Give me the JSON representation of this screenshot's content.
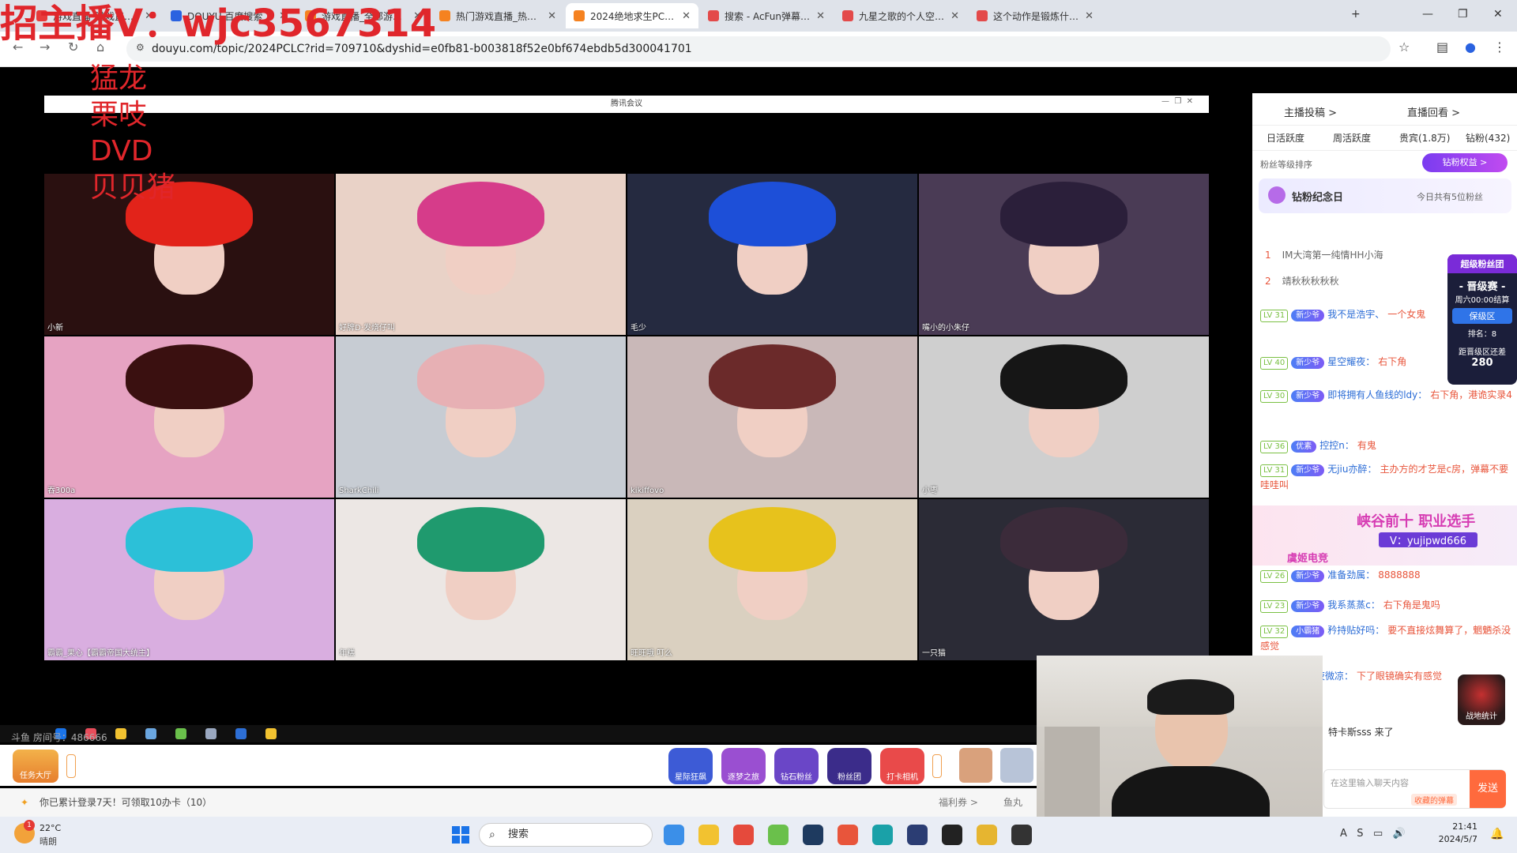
{
  "browser": {
    "tabs": [
      {
        "title": "游戏直播_游戏直播...",
        "color": "#e73b3b"
      },
      {
        "title": "DOUYU 百度搜索",
        "color": "#2a62e0"
      },
      {
        "title": "游戏直播_全部游戏直播...",
        "color": "#f58220"
      },
      {
        "title": "热门游戏直播_热门游戏视...",
        "color": "#f58220"
      },
      {
        "title": "2024绝地求生PCL春季...",
        "color": "#f58220"
      },
      {
        "title": "搜索 - AcFun弹幕视频网",
        "color": "#e34a4a"
      },
      {
        "title": "九星之歌的个人空间 -Ac...",
        "color": "#e34a4a"
      },
      {
        "title": "这个动作是锻炼什么的?",
        "color": "#e34a4a"
      }
    ],
    "active_tab_index": 4,
    "url": "douyu.com/topic/2024PCLC?rid=709710&dyshid=e0fb81-b003818f52e0bf674ebdb5d300041701"
  },
  "overlay": {
    "title": "招主播V：wjc3567314",
    "names": [
      "猛龙",
      "栗吱",
      "DVD",
      "贝贝猪"
    ],
    "color": "#e0262b"
  },
  "meeting": {
    "window_title": "腾讯会议",
    "tiles": [
      {
        "label": "小新",
        "hair": "#e2231a",
        "bg": "#2a1010"
      },
      {
        "label": "好牌D·发烧仔叫",
        "hair": "#d63c8a",
        "bg": "#e9d2c7"
      },
      {
        "label": "毛少",
        "hair": "#1d4fd8",
        "bg": "#252a40"
      },
      {
        "label": "嘴小的小朱仔",
        "hair": "#2b1f3a",
        "bg": "#4a3b55"
      },
      {
        "label": "吞300a",
        "hair": "#3a1010",
        "bg": "#e6a3c2"
      },
      {
        "label": "SharkChili",
        "hair": "#e7b0b4",
        "bg": "#c7ccd3"
      },
      {
        "label": "kikiffovo",
        "hair": "#6b2a2a",
        "bg": "#c9b8b8"
      },
      {
        "label": "小枣",
        "hair": "#161616",
        "bg": "#cfcfcf"
      },
      {
        "label": "霸霸_果心【霸霸帝国大统主】",
        "hair": "#2cc0d8",
        "bg": "#d9aee0"
      },
      {
        "label": "年糕",
        "hair": "#1f9a6e",
        "bg": "#ece7e4"
      },
      {
        "label": "旺旺哦 叮么",
        "hair": "#e7c21c",
        "bg": "#dad0c0"
      },
      {
        "label": "一只猫",
        "hair": "#3b2b3a",
        "bg": "#2b2b36"
      }
    ]
  },
  "stream": {
    "room_number": "斗鱼 房间号：486666"
  },
  "douyu_bar": {
    "task_hall": "任务大厅",
    "gifts": [
      "星际狂飙",
      "逐梦之旅",
      "钻石粉丝",
      "粉丝团",
      "打卡相机"
    ],
    "gift_colors": [
      "#3d5bd6",
      "#9a4fd1",
      "#6a46c7",
      "#3b2c8a",
      "#e94a4a"
    ],
    "login_message": "你已累计登录7天！可领取10办卡（10）",
    "welfare": "福利券 >",
    "fish": "鱼丸"
  },
  "sidebar": {
    "top_links": [
      "主播投稿 >",
      "直播回看 >"
    ],
    "tabs": [
      "日活跃度",
      "周活跃度",
      "贵宾(1.8万)",
      "钻粉(432)"
    ],
    "fan_sort": "粉丝等级排序",
    "diamond_btn": "钻粉权益 >",
    "anniversary": "钻粉纪念日",
    "today_count": "今日共有5位粉丝",
    "rank_list": [
      {
        "rank": "1",
        "name": "IM大湾第一纯情HH小海"
      },
      {
        "rank": "2",
        "name": "靖秋秋秋秋秋"
      }
    ],
    "rank_card": {
      "title": "超级粉丝团",
      "event": "- 晋级赛 -",
      "time": "周六00:00结算",
      "zone": "保级区",
      "rank": "排名：8",
      "gap_label": "距晋级区还差",
      "gap": "280"
    },
    "chats": [
      {
        "lv": "LV 31",
        "badge": "新少爷",
        "user": "我不是浩宇、",
        "text": "一个女鬼"
      },
      {
        "lv": "LV 40",
        "badge": "新少爷",
        "user": "星空耀夜：",
        "text": "右下角"
      },
      {
        "lv": "LV 30",
        "badge": "新少爷",
        "user": "即将拥有人鱼线的ldy：",
        "text": "右下角，港诡实录4"
      },
      {
        "lv": "LV 36",
        "badge": "优素",
        "user": "控控n：",
        "text": "有鬼"
      },
      {
        "lv": "LV 31",
        "badge": "新少爷",
        "user": "无jiu亦醉：",
        "text": "主办方的才艺是c房，弹幕不要哇哇叫"
      },
      {
        "lv": "LV 26",
        "badge": "新少爷",
        "user": "准备劲属：",
        "text": "8888888"
      },
      {
        "lv": "LV 23",
        "badge": "新少爷",
        "user": "我系蒸蒸c：",
        "text": "右下角是鬼吗"
      },
      {
        "lv": "LV 32",
        "badge": "小霸猪",
        "user": "矜持贴好吗：",
        "text": "要不直接炫舞算了，魍魉杀没感觉"
      },
      {
        "lv": "",
        "badge": "新少爷",
        "user": "夏日夜微凉：",
        "text": "下了眼镜确实有感觉"
      }
    ],
    "banner_title": "峡谷前十 职业选手",
    "banner_contact": "V：yujipwd666",
    "banner_brand": "虞姬电竞",
    "arrival": "特卡斯sss 来了",
    "input_placeholder": "在这里输入聊天内容",
    "barrage_btn": "收藏的弹幕",
    "send_btn": "发送",
    "battle": "战地统计"
  },
  "taskbar": {
    "weather_temp": "22°C",
    "weather_desc": "晴朗",
    "search_placeholder": "搜索",
    "notif_count": "1",
    "time": "21:41",
    "date": "2024/5/7",
    "app_colors": [
      "#3b8fe8",
      "#f2c230",
      "#e54a3c",
      "#6ac04b",
      "#1e3a5f",
      "#e8553b",
      "#1aa1a8",
      "#2b3d73",
      "#222",
      "#e6b530",
      "#333"
    ]
  }
}
